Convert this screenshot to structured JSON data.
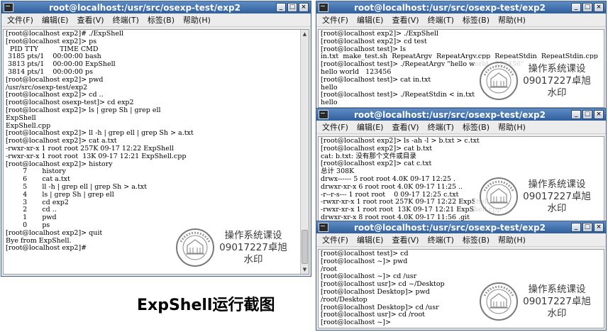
{
  "menu_labels": [
    "文件(F)",
    "编辑(E)",
    "查看(V)",
    "终端(T)",
    "标签(B)",
    "帮助(H)"
  ],
  "window_controls": {
    "minimize": "_",
    "maximize": "□",
    "close": "×"
  },
  "watermark": {
    "line1": "操作系统课设",
    "line2": "09017227卓旭",
    "line3": "水印"
  },
  "caption": "ExpShell运行截图",
  "windows": [
    {
      "title": "root@localhost:/usr/src/osexp-test/exp2",
      "lines": [
        "[root@localhost exp2]# ./ExpShell",
        "[root@localhost exp2]> ps",
        "  PID TTY          TIME CMD",
        " 3185 pts/1    00:00:00 bash",
        " 3813 pts/1    00:00:00 ExpShell",
        " 3814 pts/1    00:00:00 ps",
        "[root@localhost exp2]> pwd",
        "/usr/src/osexp-test/exp2",
        "[root@localhost exp2]> cd ..",
        "[root@localhost osexp-test]> cd exp2",
        "[root@localhost exp2]> ls | grep Sh | grep ell",
        "ExpShell",
        "ExpShell.cpp",
        "[root@localhost exp2]> ll -h | grep ell | grep Sh > a.txt",
        "[root@localhost exp2]> cat a.txt",
        "-rwxr-xr-x 1 root root 257K 09-17 12:22 ExpShell",
        "-rwxr-xr-x 1 root root  13K 09-17 12:21 ExpShell.cpp",
        "[root@localhost exp2]> history",
        "        7       history",
        "        6       cat a.txt",
        "        5       ll -h | grep ell | grep Sh > a.txt",
        "        4       ls | grep Sh | grep ell",
        "        3       cd exp2",
        "        2       cd ..",
        "        1       pwd",
        "        0       ps",
        "[root@localhost exp2]> quit",
        "Bye from ExpShell.",
        "[root@localhost exp2]#"
      ]
    },
    {
      "title": "root@localhost:/usr/src/osexp-test/exp2",
      "lines": [
        "[root@localhost exp2]> ./ExpShell",
        "[root@localhost exp2]> cd test",
        "[root@localhost test]> ls",
        "in.txt  make_test.sh  RepeatArgv  RepeatArgv.cpp  RepeatStdin  RepeatStdin.cpp",
        "[root@localhost test]> ./RepeatArgv \"hello world   123456\"",
        "hello world   123456",
        "[root@localhost test]> cat in.txt",
        "hello",
        "[root@localhost test]> ./RepeatStdin < in.txt",
        "hello"
      ]
    },
    {
      "title": "root@localhost:/usr/src/osexp-test/exp2",
      "lines": [
        "[root@localhost exp2]> ls -ah -l > b.txt > c.txt",
        "[root@localhost exp2]> cat b.txt",
        "cat: b.txt: 没有那个文件或目录",
        "[root@localhost exp2]> cat c.txt",
        "总计 308K",
        "drwx------ 5 root root 4.0K 09-17 12:25 .",
        "drwxr-xr-x 6 root root 4.0K 09-17 11:25 ..",
        "-r--r-s--- 1 root root    0 09-17 12:25 c.txt",
        "-rwxr-xr-x 1 root root 257K 09-17 12:22 ExpShell",
        "-rwxr-xr-x 1 root root  13K 09-17 12:21 ExpShell.cpp",
        "drwxr-xr-x 8 root root 4.0K 09-17 11:56 .git"
      ]
    },
    {
      "title": "root@localhost:/usr/src/osexp-test/exp2",
      "lines": [
        "[root@localhost test]> cd",
        "[root@localhost ~]> pwd",
        "/root",
        "[root@localhost ~]> cd /usr",
        "[root@localhost usr]> cd ~/Desktop",
        "[root@localhost Desktop]> pwd",
        "/root/Desktop",
        "[root@localhost Desktop]> cd /usr",
        "[root@localhost usr]> cd /root",
        "[root@localhost ~]>"
      ]
    }
  ]
}
